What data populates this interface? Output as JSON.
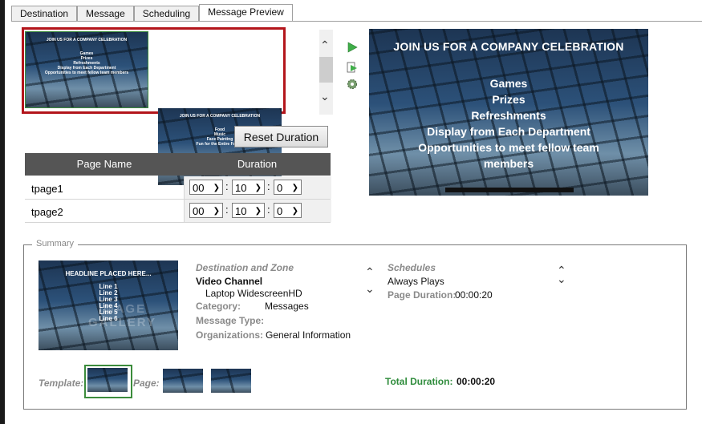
{
  "tabs": [
    "Destination",
    "Message",
    "Scheduling",
    "Message Preview"
  ],
  "slides": [
    {
      "title": "JOIN US FOR A COMPANY CELEBRATION",
      "lines": [
        "Games",
        "Prizes",
        "Refreshments",
        "Display from Each Department",
        "Opportunities to meet fellow team members"
      ]
    },
    {
      "title": "JOIN US FOR A COMPANY CELEBRATION",
      "lines": [
        "Food",
        "Music",
        "Face Painting",
        "Fun for the Entire Family"
      ]
    }
  ],
  "preview": {
    "title": "JOIN US FOR A COMPANY CELEBRATION",
    "lines": [
      "Games",
      "Prizes",
      "Refreshments",
      "Display from Each Department",
      "Opportunities to meet fellow team",
      "members"
    ]
  },
  "reset_button": "Reset Duration",
  "table": {
    "headers": [
      "Page Name",
      "Duration"
    ],
    "rows": [
      {
        "name": "tpage1",
        "hh": "00",
        "mm": "10",
        "ss": "0"
      },
      {
        "name": "tpage2",
        "hh": "00",
        "mm": "10",
        "ss": "0"
      }
    ],
    "separator": ":"
  },
  "summary": {
    "legend": "Summary",
    "template_headline": "HEADLINE PLACED HERE...",
    "template_lines": [
      "Line 1",
      "Line 2",
      "Line 3",
      "Line 4",
      "Line 5",
      "Line 6"
    ],
    "template_watermark": "IMAGE GALLERY",
    "destination_label": "Destination and Zone",
    "channel": "Video Channel",
    "zone": "Laptop WidescreenHD",
    "category_label": "Category:",
    "category": "Messages",
    "message_type_label": "Message Type:",
    "organizations_label": "Organizations:",
    "organizations": "General Information",
    "schedules_label": "Schedules",
    "schedule": "Always Plays",
    "page_duration_label": "Page Duration:",
    "page_duration": "00:00:20",
    "template_label": "Template:",
    "page_label": "Page:",
    "total_duration_label": "Total Duration:",
    "total_duration": "00:00:20"
  },
  "icons": {
    "scroll_up": "chevron-up-icon",
    "scroll_down": "chevron-down-icon",
    "play": "play-icon",
    "play_page": "play-page-icon",
    "settings": "gear-icon"
  },
  "colors": {
    "selection_red": "#b3151b",
    "header_gray": "#555555",
    "total_green": "#2f8c3c"
  }
}
